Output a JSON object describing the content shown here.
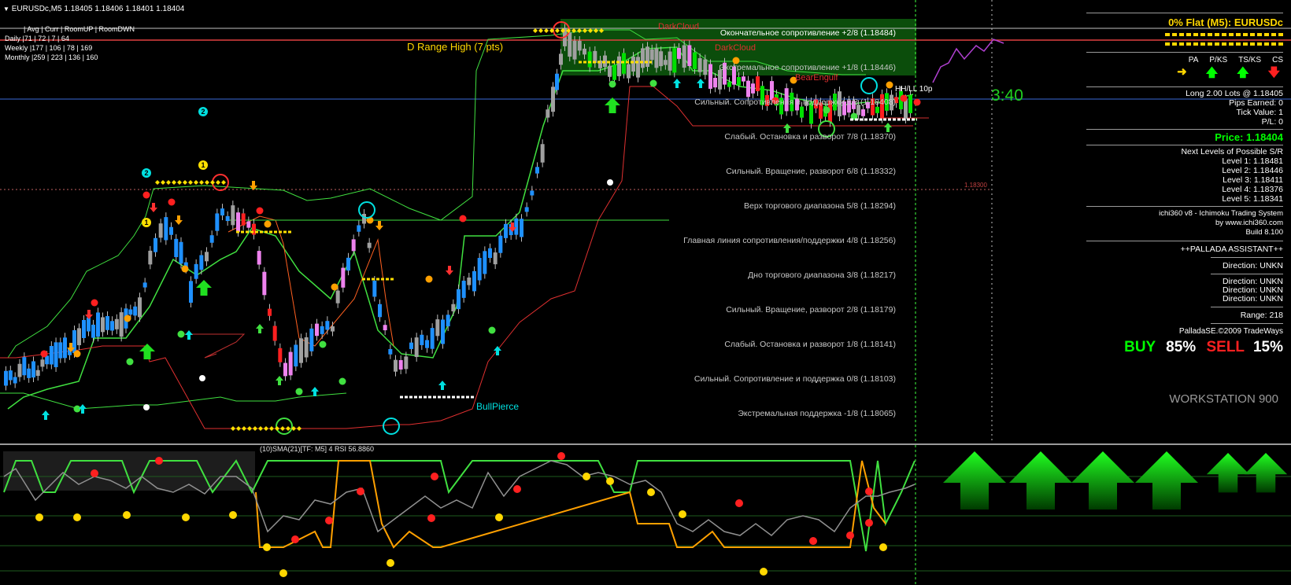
{
  "header": {
    "symbol": "EURUSDc,M5",
    "quote": "1.18405 1.18406 1.18401 1.18404"
  },
  "stats": {
    "line0": "| Avg | Curr | RoomUP | RoomDWN",
    "daily": "Daily     |71 | 72 | 7 | 64",
    "weekly": "Weekly   |177 | 106 | 78 | 169",
    "monthly": "Monthly |259 | 223 | 136 | 160"
  },
  "annotations": {
    "drange": "D Range High (7 pts)",
    "timer": "3:40",
    "bullpierce": "BullPierce",
    "darkcloud1": "DarkCloud",
    "darkcloud2": "DarkCloud",
    "bearengulf1": "BearEngulf",
    "bearengulf2": "BearEngulf",
    "hhll": "HH/LL 10p",
    "price_tag": "1.18300",
    "subwin": "(10)SMA(21)[TF: M5] 4 RSI 56.8860",
    "marker_1a": "1",
    "marker_1b": "1",
    "marker_2a": "2",
    "marker_2b": "2"
  },
  "murrey": [
    {
      "label": "Окончательное сопротивление +2/8  (1.18484)",
      "color": "#ffffff"
    },
    {
      "label": "Экстремальное сопротивление +1/8  (1.18446)",
      "color": "#c8c8c8"
    },
    {
      "label": "Сильный. Сопротивления и поддержки 8/8  (1.18408)",
      "color": "#c8c8c8"
    },
    {
      "label": "Слабый. Остановка и разворот 7/8  (1.18370)",
      "color": "#c8c8c8"
    },
    {
      "label": "Сильный. Вращение, разворот 6/8  (1.18332)",
      "color": "#c8c8c8"
    },
    {
      "label": "Верх торгового диапазона 5/8  (1.18294)",
      "color": "#c8c8c8"
    },
    {
      "label": "Главная линия сопротивления/поддержки 4/8  (1.18256)",
      "color": "#c8c8c8"
    },
    {
      "label": "Дно торгового диапазона 3/8  (1.18217)",
      "color": "#c8c8c8"
    },
    {
      "label": "Сильный. Вращение, разворот 2/8  (1.18179)",
      "color": "#c8c8c8"
    },
    {
      "label": "Слабый. Остановка и разворот 1/8  (1.18141)",
      "color": "#c8c8c8"
    },
    {
      "label": "Сильный. Сопротивление и поддержка 0/8  (1.18103)",
      "color": "#c8c8c8"
    },
    {
      "label": "Экстремальная поддержка -1/8  (1.18065)",
      "color": "#c8c8c8"
    }
  ],
  "panel": {
    "title": "0% Flat (M5): EURUSDc",
    "cols": [
      "PA",
      "P/KS",
      "TS/KS",
      "CS"
    ],
    "trade": [
      "Long 2.00 Lots @ 1.18405",
      "Pips Earned: 0",
      "Tick Value: 1",
      "P/L: 0"
    ],
    "price": "Price: 1.18404",
    "levels_title": "Next Levels of Possible S/R",
    "levels": [
      "Level 1: 1.18481",
      "Level 2: 1.18446",
      "Level 3: 1.18411",
      "Level 4: 1.18376",
      "Level 5: 1.18341"
    ],
    "ichi": [
      "ichi360 v8 - Ichimoku Trading System",
      "by www.ichi360.com",
      "Build 8.100"
    ],
    "palladaTitle": "++PALLADA ASSISTANT++",
    "dir1": "Direction: UNKN",
    "dirs": [
      "Direction: UNKN",
      "Direction: UNKN",
      "Direction: UNKN"
    ],
    "range": "Range: 218",
    "copyright": "PalladaSE.©2009 TradeWays",
    "buy": "BUY",
    "buyPct": "85%",
    "sell": "SELL",
    "sellPct": "15%",
    "workstation": "WORKSTATION 900"
  },
  "colors": {
    "bull": "#1e90ff",
    "bear": "#ff2020",
    "green": "#00e000",
    "gray": "#a0a0a0",
    "pink": "#ee82ee",
    "yellow": "#ffd700",
    "orange": "#ffa000",
    "cyan": "#00e0e0",
    "hline": "#e04040",
    "panelGreen": "#00ff00",
    "panelYellow": "#ffd700"
  }
}
